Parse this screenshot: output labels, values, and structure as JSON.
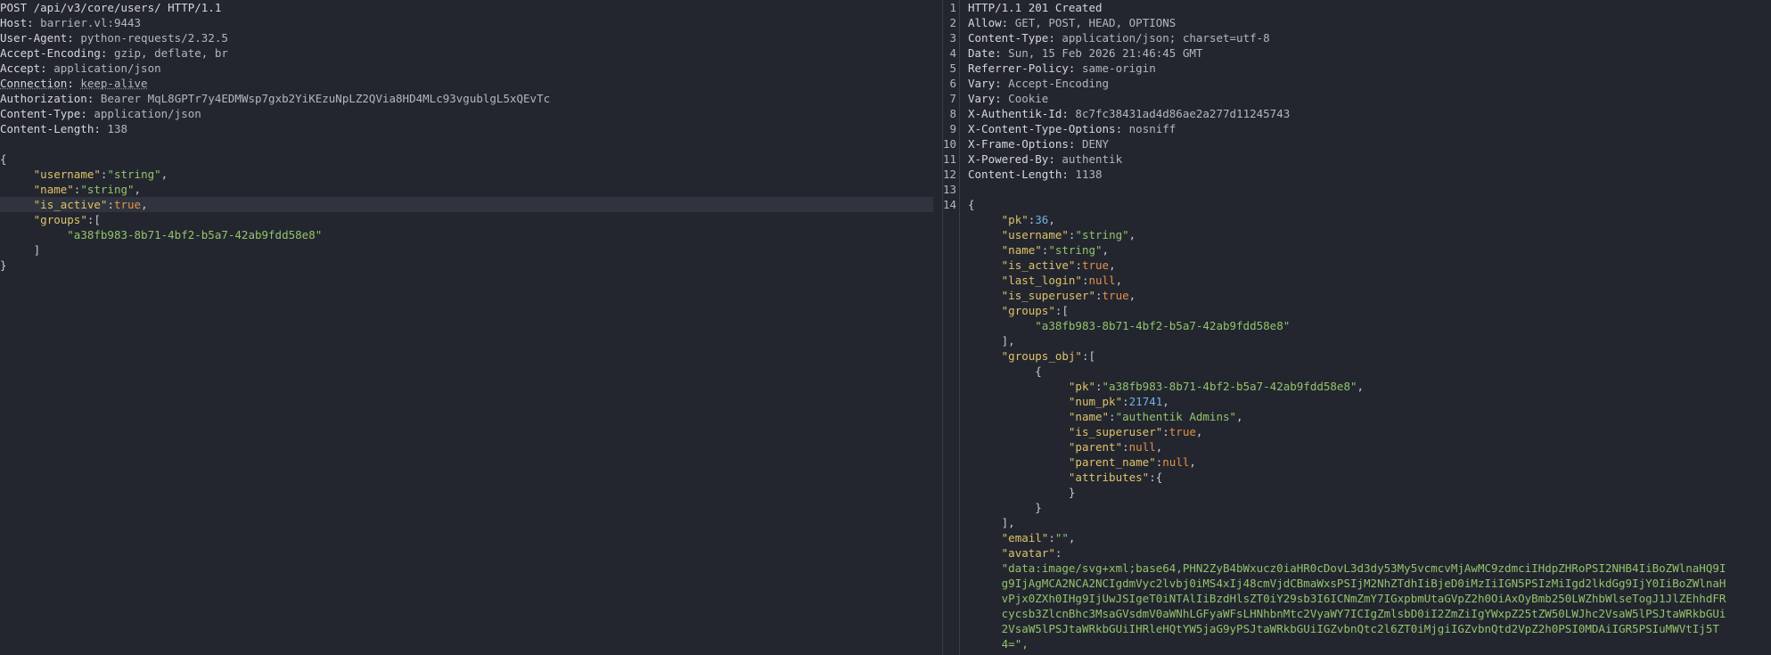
{
  "request": {
    "request_line": "POST /api/v3/core/users/ HTTP/1.1",
    "headers": [
      {
        "key": "Host",
        "value": "barrier.vl:9443"
      },
      {
        "key": "User-Agent",
        "value": "python-requests/2.32.5"
      },
      {
        "key": "Accept-Encoding",
        "value": "gzip, deflate, br"
      },
      {
        "key": "Accept",
        "value": "application/json"
      },
      {
        "key": "Connection",
        "value": "keep-alive"
      },
      {
        "key": "Authorization",
        "value": "Bearer MqL8GPTr7y4EDMWsp7gxb2YiKEzuNpLZ2QVia8HD4MLc93vgublgL5xQEvTc"
      },
      {
        "key": "Content-Type",
        "value": "application/json"
      },
      {
        "key": "Content-Length",
        "value": "138"
      }
    ],
    "body": {
      "open_brace": "{",
      "username_key": "\"username\"",
      "username_val": "\"string\"",
      "name_key": "\"name\"",
      "name_val": "\"string\"",
      "is_active_key": "\"is_active\"",
      "is_active_val": "true",
      "groups_key": "\"groups\"",
      "group_id": "\"a38fb983-8b71-4bf2-b5a7-42ab9fdd58e8\"",
      "close_bracket": "]",
      "close_brace": "}"
    }
  },
  "response": {
    "line_numbers": [
      "1",
      "2",
      "3",
      "4",
      "5",
      "6",
      "7",
      "8",
      "9",
      "10",
      "11",
      "12",
      "13",
      "14"
    ],
    "status_line": "HTTP/1.1 201 Created",
    "headers": [
      {
        "key": "Allow",
        "value": "GET, POST, HEAD, OPTIONS"
      },
      {
        "key": "Content-Type",
        "value": "application/json; charset=utf-8"
      },
      {
        "key": "Date",
        "value": "Sun, 15 Feb 2026 21:46:45 GMT"
      },
      {
        "key": "Referrer-Policy",
        "value": "same-origin"
      },
      {
        "key": "Vary",
        "value": "Accept-Encoding"
      },
      {
        "key": "Vary",
        "value": "Cookie"
      },
      {
        "key": "X-Authentik-Id",
        "value": "8c7fc38431ad4d86ae2a277d11245743"
      },
      {
        "key": "X-Content-Type-Options",
        "value": "nosniff"
      },
      {
        "key": "X-Frame-Options",
        "value": "DENY"
      },
      {
        "key": "X-Powered-By",
        "value": "authentik"
      },
      {
        "key": "Content-Length",
        "value": "1138"
      }
    ],
    "body": {
      "pk_key": "\"pk\"",
      "pk_val": "36",
      "username_key": "\"username\"",
      "username_val": "\"string\"",
      "name_key": "\"name\"",
      "name_val": "\"string\"",
      "is_active_key": "\"is_active\"",
      "is_active_val": "true",
      "last_login_key": "\"last_login\"",
      "last_login_val": "null",
      "is_superuser_key": "\"is_superuser\"",
      "is_superuser_val": "true",
      "groups_key": "\"groups\"",
      "group_id": "\"a38fb983-8b71-4bf2-b5a7-42ab9fdd58e8\"",
      "groups_obj_key": "\"groups_obj\"",
      "go_pk_key": "\"pk\"",
      "go_pk_val": "\"a38fb983-8b71-4bf2-b5a7-42ab9fdd58e8\"",
      "go_num_pk_key": "\"num_pk\"",
      "go_num_pk_val": "21741",
      "go_name_key": "\"name\"",
      "go_name_val": "\"authentik Admins\"",
      "go_is_superuser_key": "\"is_superuser\"",
      "go_is_superuser_val": "true",
      "go_parent_key": "\"parent\"",
      "go_parent_val": "null",
      "go_parent_name_key": "\"parent_name\"",
      "go_parent_name_val": "null",
      "go_attributes_key": "\"attributes\"",
      "email_key": "\"email\"",
      "email_val": "\"\"",
      "avatar_key": "\"avatar\"",
      "avatar_lines": [
        "\"data:image/svg+xml;base64,PHN2ZyB4bWxucz0iaHR0cDovL3d3dy53My5vcmcvMjAwMC9zdmciIHdpZHRoPSI2NHB4IiBoZWlnaHQ9I",
        "g9IjAgMCA2NCA2NCIgdmVyc2lvbj0iMS4xIj48cmVjdCBmaWxsPSIjM2NhZTdhIiBjeD0iMzIiIGN5PSIzMiIgd2lkdGg9IjY0IiBoZWlnaH",
        "vPjx0ZXh0IHg9IjUwJSIgeT0iNTAlIiBzdHlsZT0iY29sb3I6ICNmZmY7IGxpbmUtaGVpZ2h0OiAxOyBmb250LWZhbWlseTogJ1JlZEhhdFR",
        "cycsb3ZlcnBhc3MsaGVsdmV0aWNhLGFyaWFsLHNhbnMtc2VyaWY7ICIgZmlsbD0iI2ZmZiIgYWxpZ25tZW50LWJhc2VsaW5lPSJtaWRkbGUi",
        "2VsaW5lPSJtaWRkbGUiIHRleHQtYW5jaG9yPSJtaWRkbGUiIGZvbnQtc2l6ZT0iMjgiIGZvbnQtd2VpZ2h0PSI0MDAiIGR5PSIuMWVtIj5T",
        "4=\","
      ]
    }
  }
}
